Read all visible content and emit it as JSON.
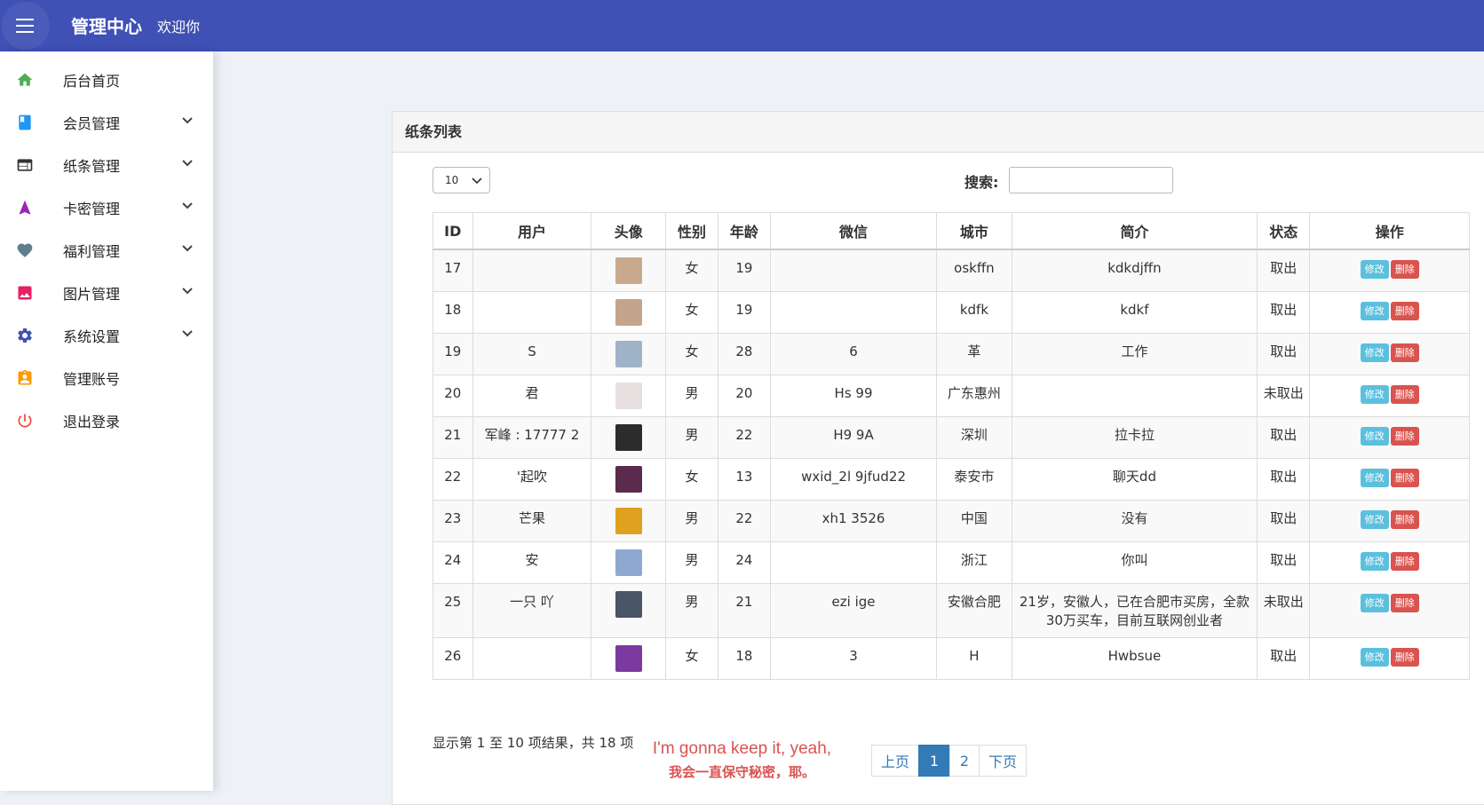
{
  "header": {
    "title": "管理中心",
    "welcome": "欢迎你"
  },
  "sidebar": {
    "items": [
      {
        "label": "后台首页",
        "icon": "home-icon",
        "color": "#4caf50",
        "expandable": false
      },
      {
        "label": "会员管理",
        "icon": "book-icon",
        "color": "#2196f3",
        "expandable": true
      },
      {
        "label": "纸条管理",
        "icon": "web-panel-icon",
        "color": "#333333",
        "expandable": true
      },
      {
        "label": "卡密管理",
        "icon": "navigation-arrow-icon",
        "color": "#9c27b0",
        "expandable": true
      },
      {
        "label": "福利管理",
        "icon": "heart-icon",
        "color": "#607d8b",
        "expandable": true
      },
      {
        "label": "图片管理",
        "icon": "image-icon",
        "color": "#e91e63",
        "expandable": true
      },
      {
        "label": "系统设置",
        "icon": "gear-icon",
        "color": "#3f51b5",
        "expandable": true
      },
      {
        "label": "管理账号",
        "icon": "account-badge-icon",
        "color": "#ff9800",
        "expandable": false
      },
      {
        "label": "退出登录",
        "icon": "power-icon",
        "color": "#f44336",
        "expandable": false
      }
    ]
  },
  "panel": {
    "title": "纸条列表",
    "length_value": "10",
    "search_label": "搜索:",
    "search_value": ""
  },
  "table": {
    "columns": [
      "ID",
      "用户",
      "头像",
      "性别",
      "年龄",
      "微信",
      "城市",
      "简介",
      "状态",
      "操作"
    ],
    "edit_label": "修改",
    "delete_label": "删除",
    "rows": [
      {
        "id": "17",
        "user": "",
        "avatar_color": "#c9a98e",
        "gender": "女",
        "age": "19",
        "wechat": "",
        "city": "oskffn",
        "intro": "kdkdjffn",
        "status": "取出"
      },
      {
        "id": "18",
        "user": "",
        "avatar_color": "#c4a48a",
        "gender": "女",
        "age": "19",
        "wechat": "",
        "city": "kdfk",
        "intro": "kdkf",
        "status": "取出"
      },
      {
        "id": "19",
        "user": "S",
        "avatar_color": "#9fb3c8",
        "gender": "女",
        "age": "28",
        "wechat": "6",
        "city": "革",
        "intro": "工作",
        "status": "取出"
      },
      {
        "id": "20",
        "user": "君",
        "avatar_color": "#e8dfe0",
        "gender": "男",
        "age": "20",
        "wechat": "Hs 99",
        "city": "广东惠州",
        "intro": "",
        "status": "未取出"
      },
      {
        "id": "21",
        "user": "军峰 : 17777 2",
        "avatar_color": "#2c2c2c",
        "gender": "男",
        "age": "22",
        "wechat": "H9 9A",
        "city": "深圳",
        "intro": "拉卡拉",
        "status": "取出"
      },
      {
        "id": "22",
        "user": "'起吹",
        "avatar_color": "#5a2b4d",
        "gender": "女",
        "age": "13",
        "wechat": "wxid_2l 9jfud22",
        "city": "泰安市",
        "intro": "聊天dd",
        "status": "取出"
      },
      {
        "id": "23",
        "user": "芒果",
        "avatar_color": "#e0a020",
        "gender": "男",
        "age": "22",
        "wechat": "xh1 3526",
        "city": "中国",
        "intro": "没有",
        "status": "取出"
      },
      {
        "id": "24",
        "user": "安",
        "avatar_color": "#8fa8cf",
        "gender": "男",
        "age": "24",
        "wechat": "",
        "city": "浙江",
        "intro": "你叫",
        "status": "取出"
      },
      {
        "id": "25",
        "user": "一只 吖",
        "avatar_color": "#4a5566",
        "gender": "男",
        "age": "21",
        "wechat": "ezi ige",
        "city": "安徽合肥",
        "intro": "21岁，安徽人，已在合肥市买房，全款30万买车，目前互联网创业者",
        "status": "未取出"
      },
      {
        "id": "26",
        "user": "",
        "avatar_color": "#7a3aa0",
        "gender": "女",
        "age": "18",
        "wechat": "3",
        "city": "H",
        "intro": "Hwbsue",
        "status": "取出"
      }
    ]
  },
  "pagination": {
    "info": "显示第 1 至 10 项结果，共 18 项",
    "prev": "上页",
    "pages": [
      "1",
      "2"
    ],
    "current": "1",
    "next": "下页"
  },
  "subtitles": {
    "line1": "I'm gonna keep it, yeah,",
    "line2": "我会一直保守秘密，耶。"
  }
}
